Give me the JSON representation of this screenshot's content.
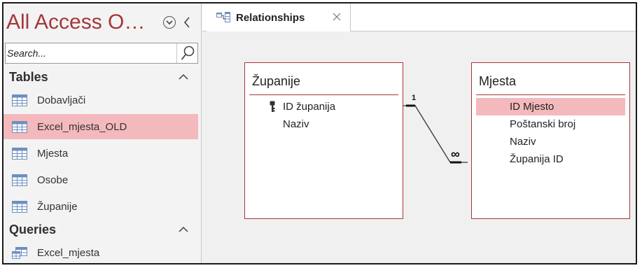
{
  "nav": {
    "title": "All Access O…",
    "search": {
      "placeholder": "Search..."
    },
    "groups": [
      {
        "label": "Tables",
        "items": [
          {
            "label": "Dobavljači",
            "icon": "table-icon",
            "selected": false
          },
          {
            "label": "Excel_mjesta_OLD",
            "icon": "table-icon",
            "selected": true
          },
          {
            "label": "Mjesta",
            "icon": "table-icon",
            "selected": false
          },
          {
            "label": "Osobe",
            "icon": "table-icon",
            "selected": false
          },
          {
            "label": "Županije",
            "icon": "table-icon",
            "selected": false
          }
        ]
      },
      {
        "label": "Queries",
        "items": [
          {
            "label": "Excel_mjesta",
            "icon": "query-icon",
            "selected": false
          }
        ]
      }
    ]
  },
  "tab": {
    "label": "Relationships",
    "icon": "relationships-icon"
  },
  "tables": [
    {
      "title": "Županije",
      "fields": [
        {
          "name": "ID županija",
          "primary_key": true,
          "selected": false
        },
        {
          "name": "Naziv",
          "primary_key": false,
          "selected": false
        }
      ]
    },
    {
      "title": "Mjesta",
      "fields": [
        {
          "name": "ID Mjesto",
          "primary_key": false,
          "selected": true
        },
        {
          "name": "Poštanski broj",
          "primary_key": false,
          "selected": false
        },
        {
          "name": "Naziv",
          "primary_key": false,
          "selected": false
        },
        {
          "name": "Županija ID",
          "primary_key": false,
          "selected": false
        }
      ]
    }
  ],
  "relationship": {
    "one_label": "1",
    "many_label": "∞"
  },
  "colors": {
    "accent": "#a4373a",
    "selection": "#f4b9bc",
    "nav_background": "#f3f3f3",
    "canvas_background": "#f0f0f0"
  }
}
